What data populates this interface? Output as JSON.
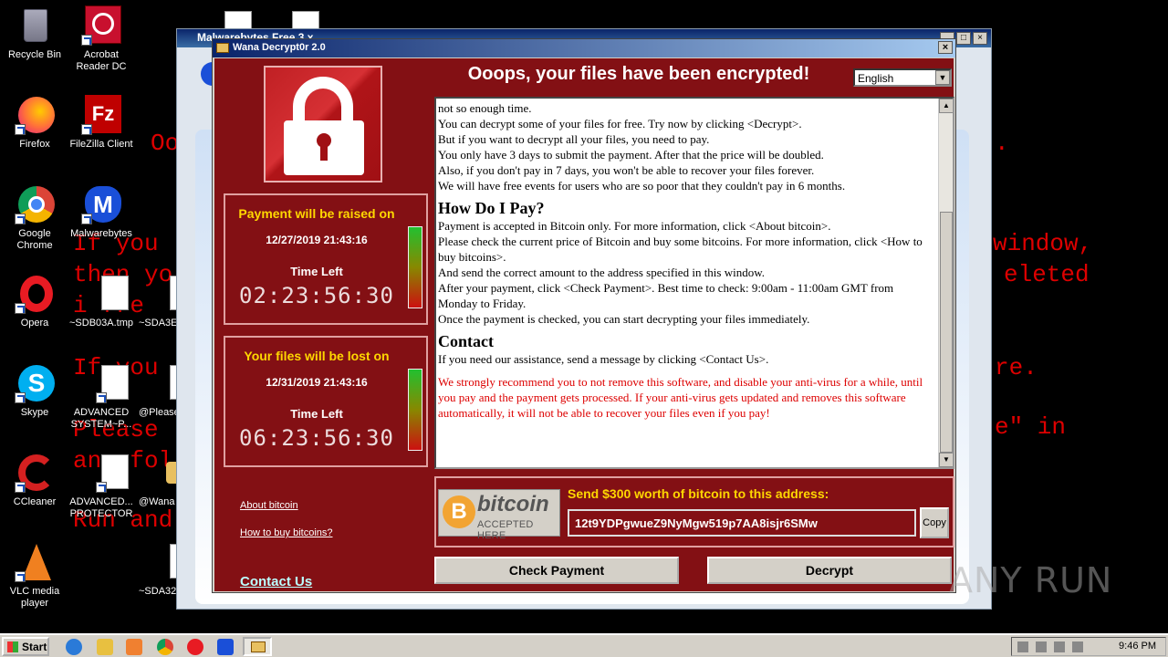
{
  "desktop": {
    "icons": [
      {
        "label": "Recycle Bin"
      },
      {
        "label": "Acrobat Reader DC"
      },
      {
        "label": "Firefox"
      },
      {
        "label": "FileZilla Client"
      },
      {
        "label": "Google Chrome"
      },
      {
        "label": "Malwarebytes"
      },
      {
        "label": "Opera"
      },
      {
        "label": "~SDB03A.tmp"
      },
      {
        "label": "~SDA3E"
      },
      {
        "label": "Skype"
      },
      {
        "label": "ADVANCED SYSTEM~P..."
      },
      {
        "label": "@Please"
      },
      {
        "label": "CCleaner"
      },
      {
        "label": "ADVANCED... PROTECTOR"
      },
      {
        "label": "@Wana"
      },
      {
        "label": "VLC media player"
      },
      {
        "label": "~SDA32"
      }
    ],
    "bg_text": {
      "l1": "If you",
      "l2": "then yo",
      "l3": "i fre",
      "l4": "If you",
      "l5": "Please",
      "l6": "any fol",
      "l7": "Run and",
      "r1": "window,",
      "r2": "eleted",
      "r3": "re.",
      "r4": "e\" in",
      "o1": "Oo",
      "dot": "."
    }
  },
  "malwarebytes_window": {
    "title": "Malwarebytes Free 3.x"
  },
  "wannacry": {
    "title": "Wana Decrypt0r 2.0",
    "close": "×",
    "headline": "Ooops, your files have been encrypted!",
    "language": "English",
    "timer1": {
      "label": "Payment will be raised on",
      "date": "12/27/2019 21:43:16",
      "time_left_label": "Time Left",
      "countdown": "02:23:56:30"
    },
    "timer2": {
      "label": "Your files will be lost on",
      "date": "12/31/2019 21:43:16",
      "time_left_label": "Time Left",
      "countdown": "06:23:56:30"
    },
    "links": {
      "about_bitcoin": "About bitcoin",
      "how_to_buy": "How to buy bitcoins?",
      "contact_us": "Contact Us"
    },
    "text": {
      "p1": "not so enough time.",
      "p2": "You can decrypt some of your files for free. Try now by clicking <Decrypt>.",
      "p3": "But if you want to decrypt all your files, you need to pay.",
      "p4": "You only have 3 days to submit the payment. After that the price will be doubled.",
      "p5": "Also, if you don't pay in 7 days, you won't be able to recover your files forever.",
      "p6": "We will have free events for users who are so poor that they couldn't pay in 6 months.",
      "h1": "How Do I Pay?",
      "p7": "Payment is accepted in Bitcoin only. For more information, click <About bitcoin>.",
      "p8": "Please check the current price of Bitcoin and buy some bitcoins. For more information, click <How to buy bitcoins>.",
      "p9": "And send the correct amount to the address specified in this window.",
      "p10": "After your payment, click <Check Payment>. Best time to check: 9:00am - 11:00am GMT from Monday to Friday.",
      "p11": "Once the payment is checked, you can start decrypting your files immediately.",
      "h2": "Contact",
      "p12": "If you need our assistance, send a message by clicking <Contact Us>.",
      "warning": "We strongly recommend you to not remove this software, and disable your anti-virus for a while, until you pay and the payment gets processed. If your anti-virus gets updated and removes this software automatically, it will not be able to recover your files even if you pay!"
    },
    "bitcoin": {
      "logo_word": "bitcoin",
      "logo_sub": "ACCEPTED HERE",
      "send_label": "Send $300 worth of bitcoin to this address:",
      "address": "12t9YDPgwueZ9NyMgw519p7AA8isjr6SMw",
      "copy": "Copy"
    },
    "buttons": {
      "check_payment": "Check Payment",
      "decrypt": "Decrypt"
    }
  },
  "watermark": "ANY RUN",
  "taskbar": {
    "start": "Start",
    "clock": "9:46 PM"
  }
}
